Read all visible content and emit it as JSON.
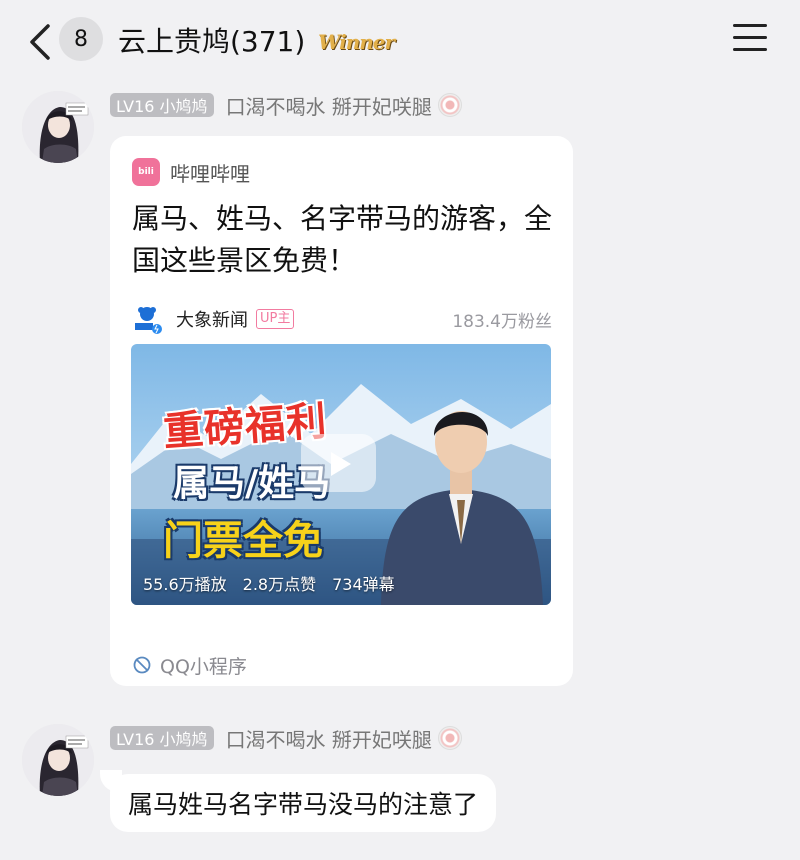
{
  "header": {
    "back_label": "back",
    "unread_count": "8",
    "title": "云上贵鸠(371)",
    "winner_badge": "Winner"
  },
  "messages": [
    {
      "level": "LV16 小鸠鸠",
      "sender": "口渴不喝水 掰开妃咲腿",
      "card": {
        "source": "哔哩哔哩",
        "title": "属马、姓马、名字带马的游客，全国这些景区免费！",
        "uploader": "大象新闻",
        "up_tag": "UP主",
        "fans": "183.4万粉丝",
        "thumb_line1": "重磅福利",
        "thumb_line2": "属马/姓马",
        "thumb_line3": "门票全免",
        "stats": [
          "55.6万播放",
          "2.8万点赞",
          "734弹幕"
        ],
        "mini_program": "QQ小程序"
      }
    },
    {
      "level": "LV16 小鸠鸠",
      "sender": "口渴不喝水 掰开妃咲腿",
      "text": "属马姓马名字带马没马的注意了"
    }
  ],
  "colors": {
    "background": "#f1f1f3",
    "bilibili_pink": "#f0729a",
    "level_tag": "#bdbdc1",
    "thumb_red": "#e8322a"
  },
  "icons": {
    "back": "chevron-left-icon",
    "menu": "hamburger-menu-icon",
    "mini_program": "mini-program-icon"
  }
}
